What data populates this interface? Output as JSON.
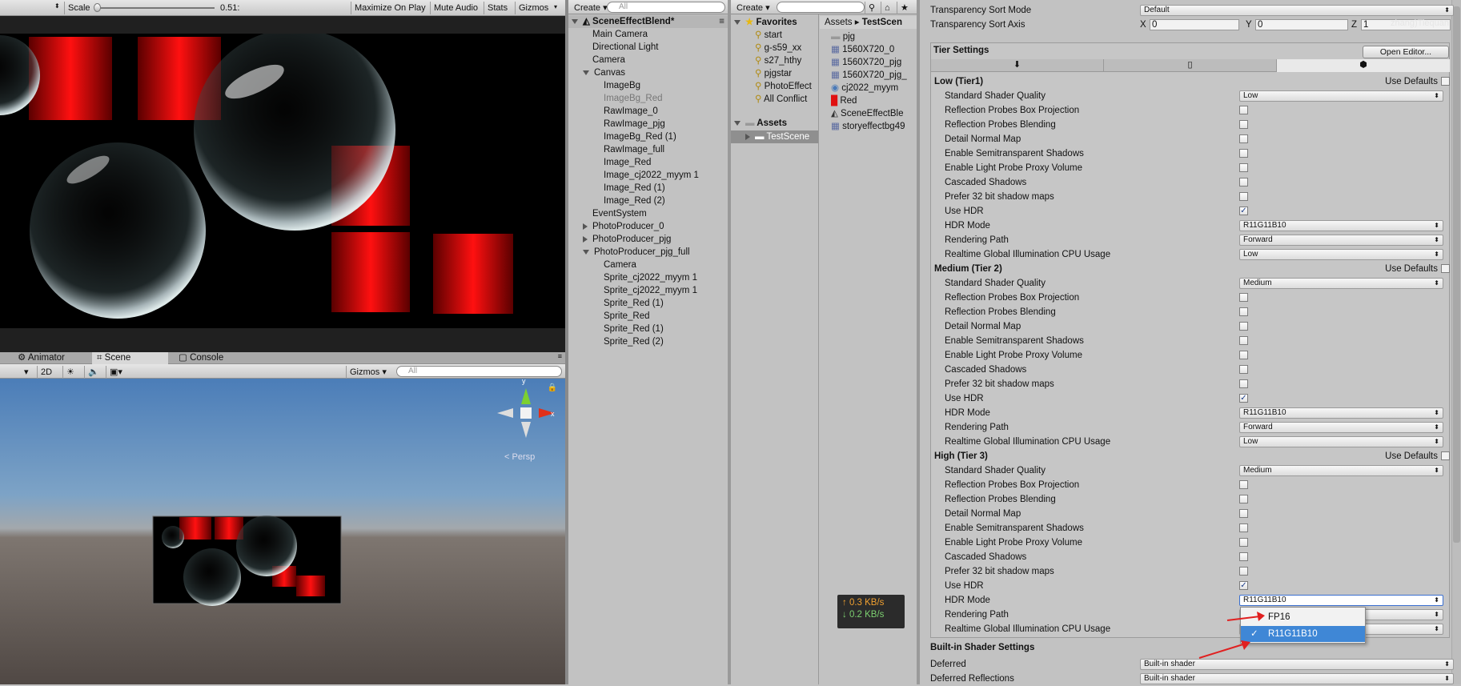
{
  "game": {
    "scale_label": "Scale",
    "scale_value": "0.51:",
    "maximize": "Maximize On Play",
    "mute": "Mute Audio",
    "stats": "Stats",
    "gizmos": "Gizmos"
  },
  "tabs": {
    "animator": "Animator",
    "scene": "Scene",
    "console": "Console"
  },
  "scene": {
    "mode_2d": "2D",
    "gizmos": "Gizmos",
    "search_placeholder": "All",
    "persp": "Persp",
    "axis_y": "y",
    "axis_x": "x"
  },
  "hierarchy": {
    "create": "Create",
    "search_placeholder": "All",
    "scene_name": "SceneEffectBlend*",
    "items": [
      {
        "label": "Main Camera",
        "indent": 1,
        "fold": "",
        "dim": false
      },
      {
        "label": "Directional Light",
        "indent": 1,
        "fold": "",
        "dim": false
      },
      {
        "label": "Camera",
        "indent": 1,
        "fold": "",
        "dim": false
      },
      {
        "label": "Canvas",
        "indent": 1,
        "fold": "open",
        "dim": false
      },
      {
        "label": "ImageBg",
        "indent": 2,
        "fold": "",
        "dim": false
      },
      {
        "label": "ImageBg_Red",
        "indent": 2,
        "fold": "",
        "dim": true
      },
      {
        "label": "RawImage_0",
        "indent": 2,
        "fold": "",
        "dim": false
      },
      {
        "label": "RawImage_pjg",
        "indent": 2,
        "fold": "",
        "dim": false
      },
      {
        "label": "ImageBg_Red (1)",
        "indent": 2,
        "fold": "",
        "dim": false
      },
      {
        "label": "RawImage_full",
        "indent": 2,
        "fold": "",
        "dim": false
      },
      {
        "label": "Image_Red",
        "indent": 2,
        "fold": "",
        "dim": false
      },
      {
        "label": "Image_cj2022_myym 1",
        "indent": 2,
        "fold": "",
        "dim": false
      },
      {
        "label": "Image_Red (1)",
        "indent": 2,
        "fold": "",
        "dim": false
      },
      {
        "label": "Image_Red (2)",
        "indent": 2,
        "fold": "",
        "dim": false
      },
      {
        "label": "EventSystem",
        "indent": 1,
        "fold": "",
        "dim": false
      },
      {
        "label": "PhotoProducer_0",
        "indent": 1,
        "fold": "closed",
        "dim": false
      },
      {
        "label": "PhotoProducer_pjg",
        "indent": 1,
        "fold": "closed",
        "dim": false
      },
      {
        "label": "PhotoProducer_pjg_full",
        "indent": 1,
        "fold": "open",
        "dim": false
      },
      {
        "label": "Camera",
        "indent": 2,
        "fold": "",
        "dim": false
      },
      {
        "label": "Sprite_cj2022_myym 1",
        "indent": 2,
        "fold": "",
        "dim": false
      },
      {
        "label": "Sprite_cj2022_myym 1",
        "indent": 2,
        "fold": "",
        "dim": false
      },
      {
        "label": "Sprite_Red (1)",
        "indent": 2,
        "fold": "",
        "dim": false
      },
      {
        "label": "Sprite_Red",
        "indent": 2,
        "fold": "",
        "dim": false
      },
      {
        "label": "Sprite_Red (1)",
        "indent": 2,
        "fold": "",
        "dim": false
      },
      {
        "label": "Sprite_Red (2)",
        "indent": 2,
        "fold": "",
        "dim": false
      }
    ]
  },
  "project": {
    "create": "Create",
    "favorites_label": "Favorites",
    "favorites": [
      "start",
      "g-s59_xx",
      "s27_hthy",
      "pjgstar",
      "PhotoEffect",
      "All Conflict"
    ],
    "assets_label": "Assets",
    "assets_folders": [
      "TestScene"
    ],
    "breadcrumb": [
      "Assets",
      "TestScen"
    ],
    "files": [
      {
        "label": "pjg",
        "type": "folder"
      },
      {
        "label": "1560X720_0",
        "type": "image"
      },
      {
        "label": "1560X720_pjg",
        "type": "image"
      },
      {
        "label": "1560X720_pjg_",
        "type": "image"
      },
      {
        "label": "cj2022_myym",
        "type": "prefab"
      },
      {
        "label": "Red",
        "type": "red"
      },
      {
        "label": "SceneEffectBle",
        "type": "unity"
      },
      {
        "label": "storyeffectbg49",
        "type": "image"
      }
    ]
  },
  "net": {
    "up": "↑ 0.3 KB/s",
    "down": "↓ 0.2 KB/s",
    "up_color": "#f0a030",
    "down_color": "#7cd070"
  },
  "inspector": {
    "sort_mode_label": "Transparency Sort Mode",
    "sort_mode_value": "Default",
    "sort_axis_label": "Transparency Sort Axis",
    "axis_x": "X",
    "axis_x_val": "0",
    "axis_y": "Y",
    "axis_y_val": "0",
    "axis_z": "Z",
    "axis_z_val": "1",
    "watermark": "zhang)Tiequan",
    "tier_settings": "Tier Settings",
    "open_editor": "Open Editor...",
    "use_defaults": "Use Defaults",
    "row_labels": [
      "Standard Shader Quality",
      "Reflection Probes Box Projection",
      "Reflection Probes Blending",
      "Detail Normal Map",
      "Enable Semitransparent Shadows",
      "Enable Light Probe Proxy Volume",
      "Cascaded Shadows",
      "Prefer 32 bit shadow maps",
      "Use HDR",
      "HDR Mode",
      "Rendering Path",
      "Realtime Global Illumination CPU Usage"
    ],
    "tiers": [
      {
        "title": "Low (Tier1)",
        "shader_quality": "Low",
        "hdr_mode": "R11G11B10",
        "rendering_path": "Forward",
        "gi_cpu": "Low"
      },
      {
        "title": "Medium (Tier 2)",
        "shader_quality": "Medium",
        "hdr_mode": "R11G11B10",
        "rendering_path": "Forward",
        "gi_cpu": "Low"
      },
      {
        "title": "High (Tier 3)",
        "shader_quality": "Medium",
        "hdr_mode": "R11G11B10",
        "rendering_path": "",
        "gi_cpu": ""
      }
    ],
    "builtin_title": "Built-in Shader Settings",
    "deferred_label": "Deferred",
    "deferred_value": "Built-in shader",
    "deferred_refl_label": "Deferred Reflections",
    "deferred_refl_value": "Built-in shader",
    "popup": {
      "options": [
        "FP16",
        "R11G11B10"
      ],
      "selected": "R11G11B10"
    }
  }
}
